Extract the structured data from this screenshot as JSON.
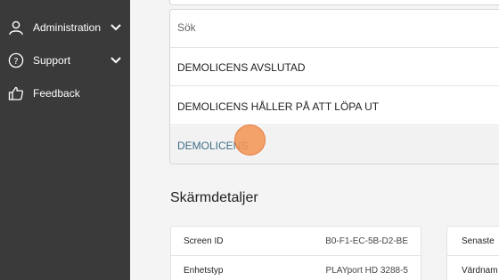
{
  "sidebar": {
    "items": [
      {
        "label": "Administration",
        "icon": "user-icon",
        "expandable": true
      },
      {
        "label": "Support",
        "icon": "help-icon",
        "expandable": true
      },
      {
        "label": "Feedback",
        "icon": "thumbs-up-icon",
        "expandable": false
      }
    ]
  },
  "dropdown": {
    "search_placeholder": "Sök",
    "options": [
      "DEMOLICENS AVSLUTAD",
      "DEMOLICENS HÅLLER PÅ ATT LÖPA UT",
      "DEMOLICENS"
    ],
    "highlighted_index": 2
  },
  "details": {
    "title": "Skärmdetaljer",
    "rows": [
      {
        "label": "Screen ID",
        "value": "B0-F1-EC-5B-D2-BE"
      },
      {
        "label": "Enhetstyp",
        "value": "PLAYport HD 3288-5"
      }
    ],
    "right_rows": [
      {
        "label": "Senaste"
      },
      {
        "label": "Värdnam"
      }
    ]
  },
  "colors": {
    "sidebar_bg": "#3a3a3a",
    "highlight_text": "#3f6f85",
    "cursor": "#f39452"
  }
}
